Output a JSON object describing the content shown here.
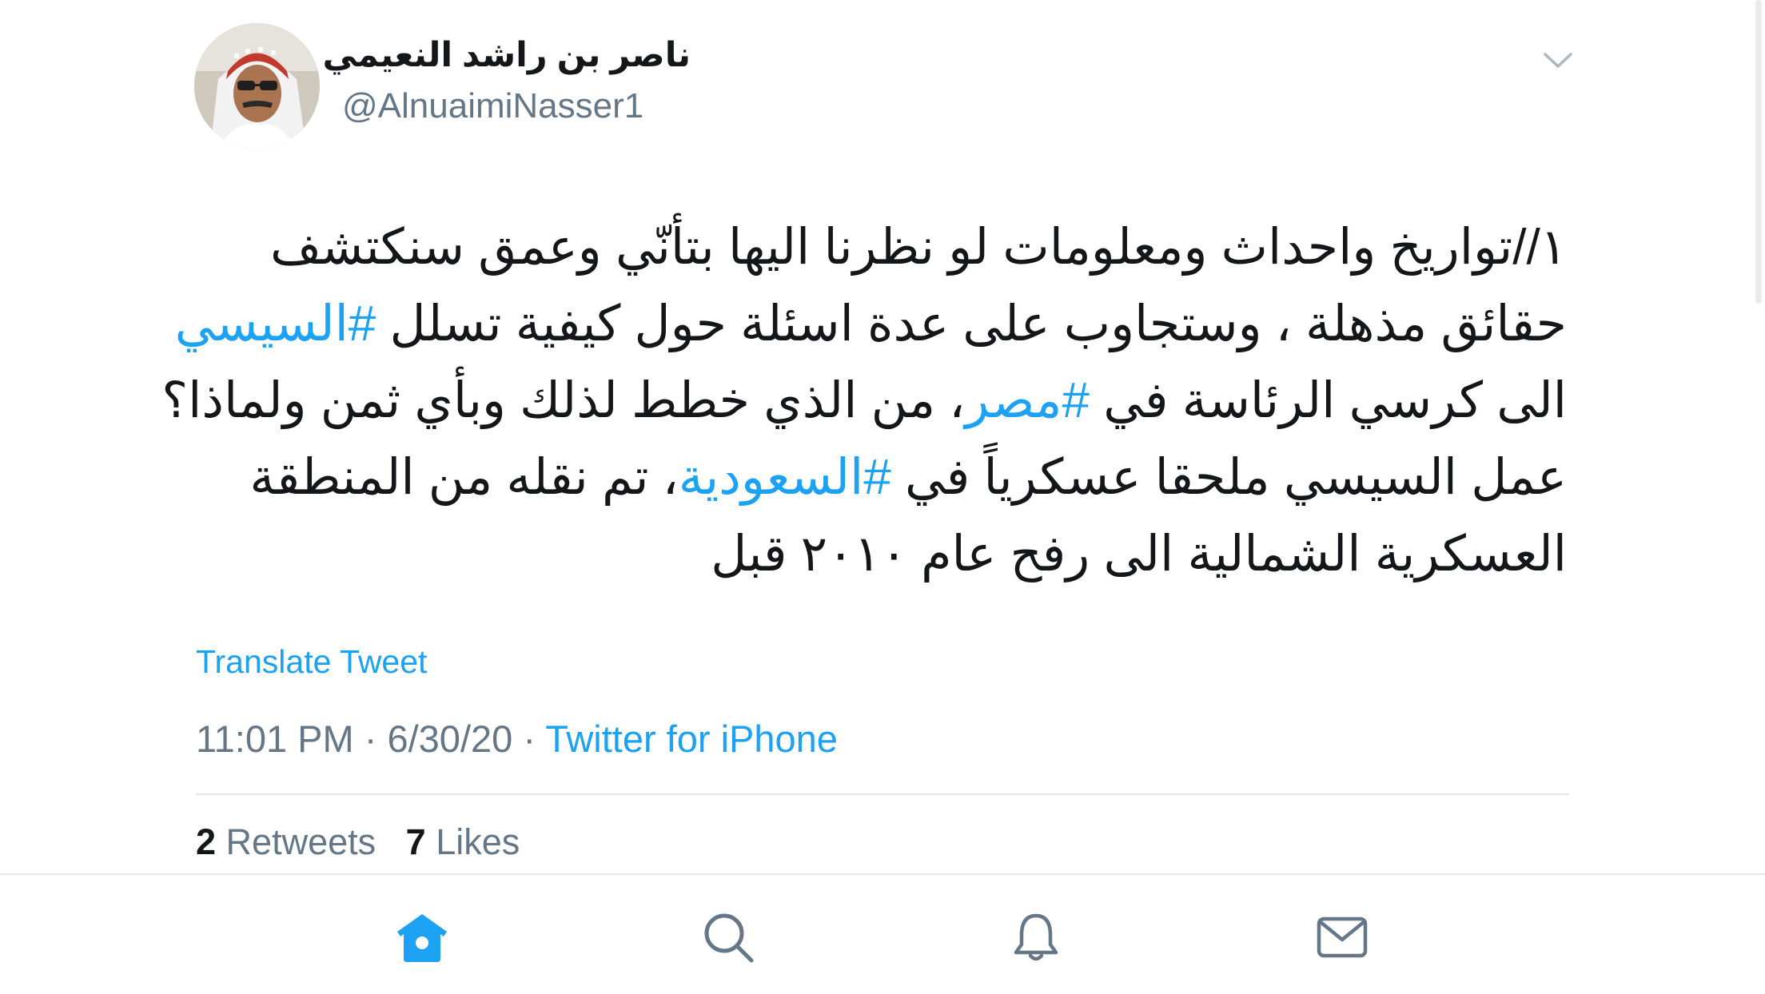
{
  "tweet": {
    "display_name": "ناصر بن راشد النعيمي",
    "handle": "@AlnuaimiNasser1",
    "text_lines": [
      [
        {
          "t": "١//تواريخ  واحداث ومعلومات لو نظرنا اليها بتأنّي وعمق سنكتشف",
          "tag": false
        }
      ],
      [
        {
          "t": "حقائق مذهلة ، وستجاوب على عدة اسئلة حول كيفية تسلل ",
          "tag": false
        },
        {
          "t": "#السيسي",
          "tag": true
        }
      ],
      [
        {
          "t": "الى كرسي الرئاسة في ",
          "tag": false
        },
        {
          "t": "#مصر",
          "tag": true
        },
        {
          "t": "، من الذي خطط لذلك وبأي ثمن ولماذا؟",
          "tag": false
        }
      ],
      [
        {
          "t": "عمل السيسي ملحقا عسكرياً في ",
          "tag": false
        },
        {
          "t": "#السعودية",
          "tag": true
        },
        {
          "t": "، تم نقله من المنطقة",
          "tag": false
        }
      ],
      [
        {
          "t": "العسكرية الشمالية الى رفح عام ٢٠١٠ قبل",
          "tag": false
        }
      ]
    ],
    "translate_label": "Translate Tweet",
    "time": "11:01 PM",
    "separator_1": "·",
    "date": "6/30/20",
    "separator_2": "·",
    "source": "Twitter for iPhone",
    "retweets_count": "2",
    "retweets_label": "Retweets",
    "likes_count": "7",
    "likes_label": "Likes",
    "caret_icon": "chevron-down-icon"
  },
  "tabbar": {
    "items": [
      {
        "name": "home",
        "icon": "home-icon",
        "active": true
      },
      {
        "name": "search",
        "icon": "search-icon",
        "active": false
      },
      {
        "name": "notifications",
        "icon": "bell-icon",
        "active": false
      },
      {
        "name": "messages",
        "icon": "mail-icon",
        "active": false
      }
    ],
    "active_color": "#1da1f2",
    "inactive_color": "#657786"
  },
  "colors": {
    "link": "#1da1f2",
    "secondary_text": "#657786",
    "primary_text": "#14171a",
    "divider": "#e1e8ed"
  }
}
